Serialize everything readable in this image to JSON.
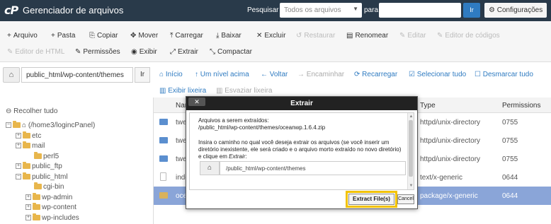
{
  "app": {
    "logo": "cP",
    "title": "Gerenciador de arquivos"
  },
  "search": {
    "label": "Pesquisar",
    "scope": "Todos os arquivos",
    "for_label": "para",
    "value": "",
    "go": "Ir",
    "settings": "Configurações"
  },
  "toolbar": {
    "row1": [
      {
        "icon": "+",
        "label": "Arquivo",
        "enabled": true
      },
      {
        "icon": "+",
        "label": "Pasta",
        "enabled": true
      },
      {
        "icon": "⎘",
        "label": "Copiar",
        "enabled": true
      },
      {
        "icon": "✥",
        "label": "Mover",
        "enabled": true
      },
      {
        "icon": "⤒",
        "label": "Carregar",
        "enabled": true
      },
      {
        "icon": "⤓",
        "label": "Baixar",
        "enabled": true
      },
      {
        "icon": "✕",
        "label": "Excluir",
        "enabled": true
      },
      {
        "icon": "↺",
        "label": "Restaurar",
        "enabled": false
      },
      {
        "icon": "▤",
        "label": "Renomear",
        "enabled": true
      },
      {
        "icon": "✎",
        "label": "Editar",
        "enabled": false
      },
      {
        "icon": "✎",
        "label": "Editor de códigos",
        "enabled": false
      }
    ],
    "row2": [
      {
        "icon": "✎",
        "label": "Editor de HTML",
        "enabled": false
      },
      {
        "icon": "✎",
        "label": "Permissões",
        "enabled": true
      },
      {
        "icon": "◉",
        "label": "Exibir",
        "enabled": true
      },
      {
        "icon": "⤢",
        "label": "Extrair",
        "enabled": true
      },
      {
        "icon": "⤡",
        "label": "Compactar",
        "enabled": true
      }
    ]
  },
  "pathbar": {
    "home_icon": "home-icon",
    "path": "public_html/wp-content/themes",
    "go": "Ir",
    "nav": [
      {
        "icon": "⌂",
        "label": "Início",
        "enabled": true
      },
      {
        "icon": "↑",
        "label": "Um nível acima",
        "enabled": true
      },
      {
        "icon": "←",
        "label": "Voltar",
        "enabled": true
      },
      {
        "icon": "→",
        "label": "Encaminhar",
        "enabled": false
      },
      {
        "icon": "⟳",
        "label": "Recarregar",
        "enabled": true
      },
      {
        "icon": "☑",
        "label": "Selecionar tudo",
        "enabled": true
      },
      {
        "icon": "☐",
        "label": "Desmarcar tudo",
        "enabled": true
      }
    ],
    "nav2": [
      {
        "icon": "🗑",
        "label": "Exibir lixeira",
        "enabled": true
      },
      {
        "icon": "🗑",
        "label": "Esvaziar lixeira",
        "enabled": false
      }
    ]
  },
  "tree": {
    "collapse_label": "Recolher tudo",
    "nodes": [
      {
        "label": "(/home3/logincPanel)",
        "level": 0,
        "pm": "−",
        "home": true
      },
      {
        "label": "etc",
        "level": 1,
        "pm": "+"
      },
      {
        "label": "mail",
        "level": 1,
        "pm": "+"
      },
      {
        "label": "perl5",
        "level": 2,
        "pm": ""
      },
      {
        "label": "public_ftp",
        "level": 1,
        "pm": "+"
      },
      {
        "label": "public_html",
        "level": 1,
        "pm": "−"
      },
      {
        "label": "cgi-bin",
        "level": 2,
        "pm": ""
      },
      {
        "label": "wp-admin",
        "level": 2,
        "pm": "+"
      },
      {
        "label": "wp-content",
        "level": 2,
        "pm": "+"
      },
      {
        "label": "wp-includes",
        "level": 2,
        "pm": "+"
      }
    ]
  },
  "table": {
    "headers": {
      "name": "Nam",
      "type": "Type",
      "permissions": "Permissions"
    },
    "rows": [
      {
        "icon": "folder",
        "name": "twe",
        "type": "httpd/unix-directory",
        "perm": "0755",
        "selected": false
      },
      {
        "icon": "folder",
        "name": "twe",
        "type": "httpd/unix-directory",
        "perm": "0755",
        "selected": false
      },
      {
        "icon": "folder",
        "name": "twe",
        "type": "httpd/unix-directory",
        "perm": "0755",
        "selected": false
      },
      {
        "icon": "doc",
        "name": "inde",
        "type": "text/x-generic",
        "perm": "0644",
        "selected": false
      },
      {
        "icon": "pkg",
        "name": "oce",
        "type": "package/x-generic",
        "perm": "0644",
        "selected": true
      }
    ]
  },
  "modal": {
    "title": "Extrair",
    "close": "✕",
    "files_label": "Arquivos a serem extraídos:",
    "file": "/public_html/wp-content/themes/oceanwp.1.6.4.zip",
    "instructions_pre": "Insira o caminho no qual você deseja extrair os arquivos (se você inserir um diretório inexistente, ele será criado e o arquivo morto extraído no novo diretório) e clique em ",
    "instructions_em": "Extrair",
    "instructions_post": ":",
    "path_value": "/public_html/wp-content/themes",
    "extract_button": "Extract File(s)",
    "cancel_button": "Cancel"
  }
}
